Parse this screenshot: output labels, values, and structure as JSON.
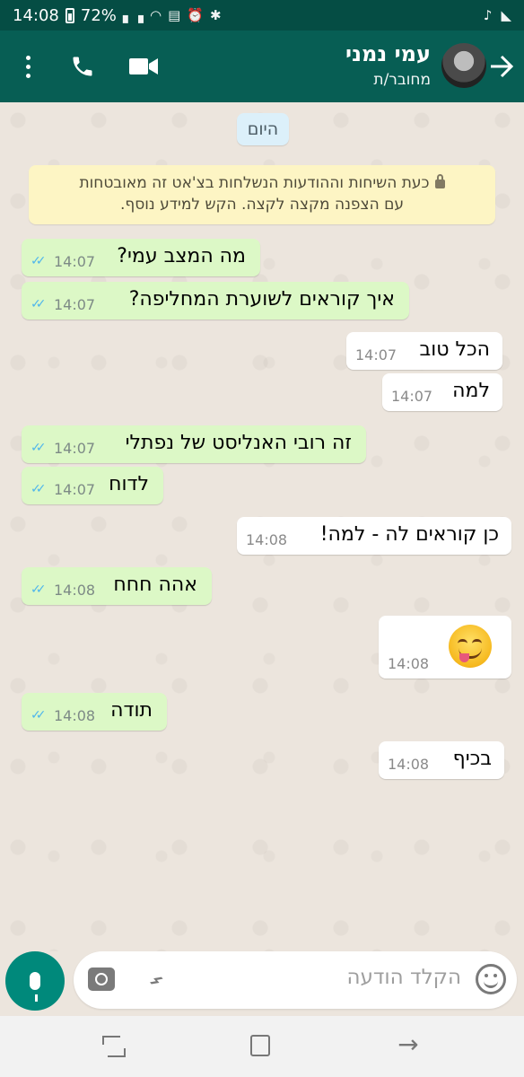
{
  "status_bar": {
    "time": "14:08",
    "battery": "72%",
    "icons": [
      "battery-icon",
      "signal-icon",
      "wifi-icon",
      "volte-icon",
      "alarm-icon",
      "bluetooth-icon",
      "music-icon",
      "app-icon"
    ]
  },
  "header": {
    "contact_name": "עמי נמני",
    "contact_status": "מחובר/ת",
    "icons": [
      "back-arrow-icon",
      "avatar",
      "video-call-icon",
      "phone-icon",
      "more-vert-icon"
    ],
    "colors": {
      "header": "#075e54",
      "status_bar": "#054d44"
    }
  },
  "chat": {
    "date_label": "היום",
    "encryption_notice_line1": "כעת השיחות וההודעות הנשלחות בצ'אט זה מאובטחות",
    "encryption_notice_line2": "עם הצפנה מקצה לקצה. הקש למידע נוסף.",
    "messages": [
      {
        "dir": "out",
        "text": "מה המצב עמי?",
        "time": "14:07",
        "read": true
      },
      {
        "dir": "out",
        "text": "איך קוראים לשוערת המחליפה?",
        "time": "14:07",
        "read": true
      },
      {
        "dir": "in",
        "text": "הכל טוב",
        "time": "14:07"
      },
      {
        "dir": "in",
        "text": "למה",
        "time": "14:07"
      },
      {
        "dir": "out",
        "text": "זה רובי האנליסט של נפתלי",
        "time": "14:07",
        "read": true
      },
      {
        "dir": "out",
        "text": "לדוח",
        "time": "14:07",
        "read": true
      },
      {
        "dir": "in",
        "text": "כן קוראים לה - למה!",
        "time": "14:08"
      },
      {
        "dir": "out",
        "text": "אהה חחח",
        "time": "14:08",
        "read": true
      },
      {
        "dir": "in",
        "emoji": "face-savoring-food-emoji",
        "time": "14:08"
      },
      {
        "dir": "out",
        "text": "תודה",
        "time": "14:08",
        "read": true
      },
      {
        "dir": "in",
        "text": "בכיף",
        "time": "14:08"
      }
    ],
    "colors": {
      "outgoing": "#dcf8c6",
      "incoming": "#ffffff",
      "read_ticks": "#4fb6ec",
      "background": "#ece5dd"
    }
  },
  "composer": {
    "placeholder": "הקלד הודעה",
    "icons": [
      "mic-icon",
      "camera-icon",
      "attach-icon",
      "emoji-icon"
    ],
    "mic_button_color": "#00897b"
  },
  "nav_bar": {
    "icons": [
      "recent-apps-icon",
      "home-icon",
      "back-icon"
    ]
  }
}
